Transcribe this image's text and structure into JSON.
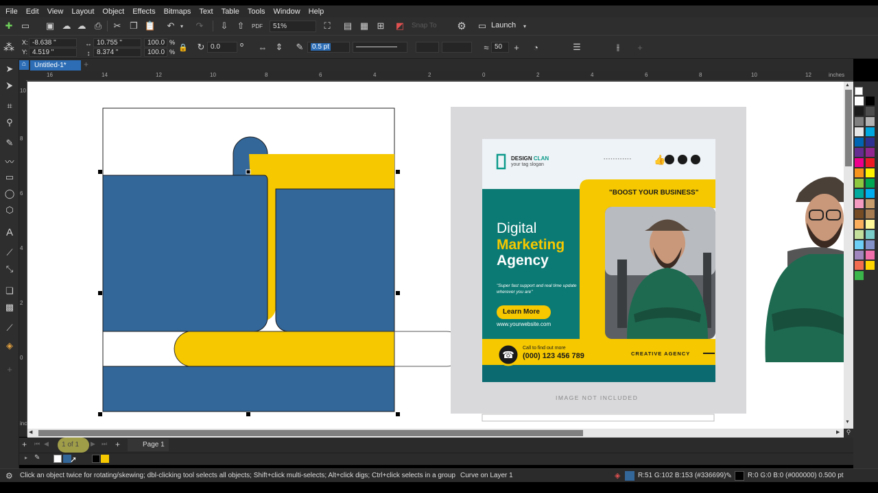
{
  "menu": [
    "File",
    "Edit",
    "View",
    "Layout",
    "Object",
    "Effects",
    "Bitmaps",
    "Text",
    "Table",
    "Tools",
    "Window",
    "Help"
  ],
  "toolbar": {
    "zoom": "51%",
    "snap_to": "Snap To",
    "launch": "Launch"
  },
  "property_bar": {
    "x": "-8.638 \"",
    "y": "4.519 \"",
    "width": "10.755 \"",
    "height": "8.374 \"",
    "scale_x": "100.0",
    "scale_y": "100.0",
    "percent_x": "%",
    "percent_y": "%",
    "rotation": "0.0",
    "outline_width": "0.5 pt",
    "smoothing": "50"
  },
  "document_tab": "Untitled-1*",
  "ruler": {
    "unit": "inches",
    "h_labels": [
      "16",
      "14",
      "12",
      "10",
      "8",
      "6",
      "4",
      "2",
      "0",
      "2",
      "4",
      "6",
      "8",
      "10",
      "12"
    ],
    "v_labels": [
      "10",
      "8",
      "6",
      "4",
      "2",
      "0"
    ]
  },
  "flyer": {
    "brand_line1": "DESIGN",
    "brand_line2": "CLAN",
    "tagline": "your tag slogan",
    "dotted": "●●●●●●●●●●●●",
    "boost": "\"BOOST YOUR BUSINESS\"",
    "heading1": "Digital",
    "heading2": "Marketing",
    "heading3": "Agency",
    "support": "\"Super fast support and real time update wherever you are\"",
    "learn_more": "Learn More",
    "website": "www.yourwebsite.com",
    "call_label": "Call to find out more",
    "phone": "(000) 123 456 789",
    "creative": "CREATIVE AGENCY",
    "image_note": "IMAGE NOT INCLUDED"
  },
  "page_nav": {
    "page_count": "1  of  1",
    "page_tab": "Page 1"
  },
  "status": {
    "hint": "Click an object twice for rotating/skewing; dbl-clicking tool selects all objects; Shift+click multi-selects; Alt+click digs; Ctrl+click selects in a group",
    "object_info": "Curve on Layer 1",
    "fill_info": "R:51 G:102 B:153 (#336699)",
    "outline_info": "R:0 G:0 B:0 (#000000)  0.500 pt"
  },
  "colors": {
    "blue": "#336699",
    "yellow": "#f5c800",
    "teal": "#0c7a74",
    "accent": "#2c6db5"
  },
  "palette_colors": [
    "#ffffff",
    "#000000",
    "#1a1a1a",
    "#4d4d4d",
    "#808080",
    "#b3b3b3",
    "#e6e6e6",
    "#00a8e0",
    "#0066b3",
    "#2e3192",
    "#662d91",
    "#92278f",
    "#ec008c",
    "#ed1c24",
    "#f7941d",
    "#fff200",
    "#8dc63f",
    "#00a651",
    "#00a99d",
    "#00aeef",
    "#f49ac1",
    "#c69c6d",
    "#754c24",
    "#a67c52",
    "#fbaf5d",
    "#fff799",
    "#c4df9b",
    "#7accc8",
    "#6dcff6",
    "#8393ca",
    "#a186be",
    "#f06eaa",
    "#f26c4f",
    "#ffd400",
    "#39b54a"
  ],
  "doc_palette": [
    "#ffffff",
    "#336699",
    "#000000",
    "#f5c800"
  ]
}
